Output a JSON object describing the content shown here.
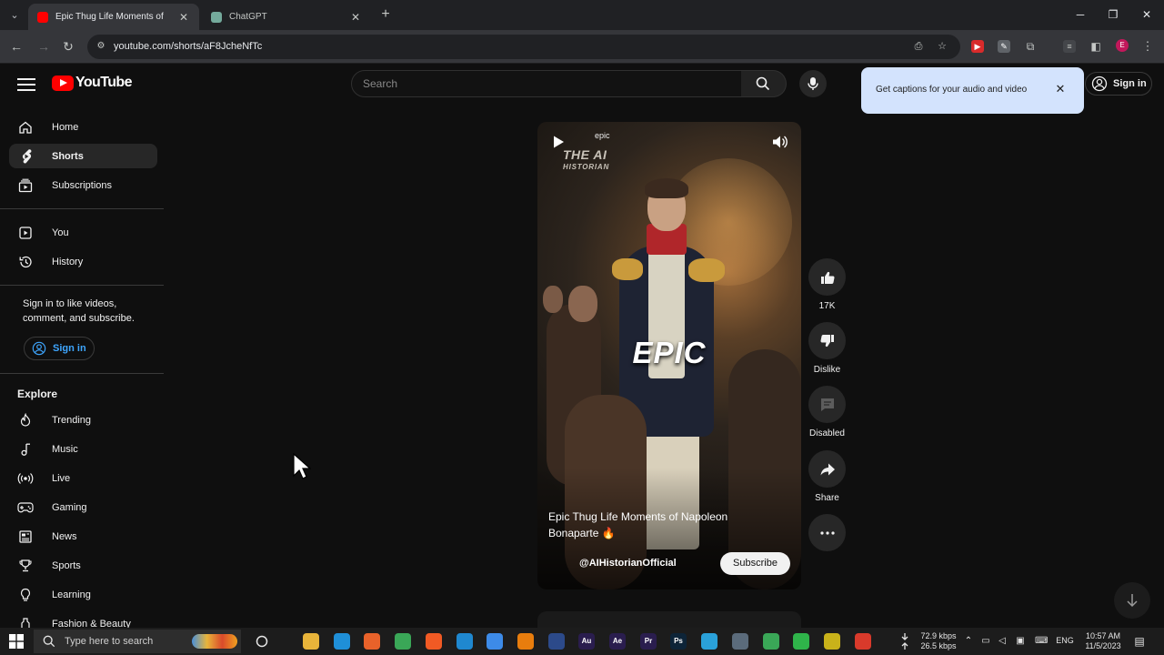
{
  "browser": {
    "tabs": [
      {
        "title": "Epic Thug Life Moments of",
        "favicon_color": "#ff0000",
        "active": true
      },
      {
        "title": "ChatGPT",
        "favicon_color": "#74aa9c",
        "active": false
      }
    ],
    "new_tab_symbol": "+",
    "url": "youtube.com/shorts/aF8JcheNfTc",
    "profile_initial": "E"
  },
  "youtube": {
    "logo_text": "YouTube",
    "search_placeholder": "Search",
    "sign_in_label": "Sign in",
    "caption_popup": "Get captions for your audio and video"
  },
  "sidebar": {
    "primary": [
      {
        "label": "Home",
        "icon": "home-icon"
      },
      {
        "label": "Shorts",
        "icon": "shorts-icon",
        "active": true
      },
      {
        "label": "Subscriptions",
        "icon": "subscriptions-icon"
      }
    ],
    "secondary": [
      {
        "label": "You",
        "icon": "you-icon"
      },
      {
        "label": "History",
        "icon": "history-icon"
      }
    ],
    "signin_note": "Sign in to like videos, comment, and subscribe.",
    "signin_label": "Sign in",
    "explore_title": "Explore",
    "explore": [
      {
        "label": "Trending",
        "icon": "trending-icon"
      },
      {
        "label": "Music",
        "icon": "music-icon"
      },
      {
        "label": "Live",
        "icon": "live-icon"
      },
      {
        "label": "Gaming",
        "icon": "gaming-icon"
      },
      {
        "label": "News",
        "icon": "news-icon"
      },
      {
        "label": "Sports",
        "icon": "sports-icon"
      },
      {
        "label": "Learning",
        "icon": "learning-icon"
      },
      {
        "label": "Fashion & Beauty",
        "icon": "fashion-icon"
      }
    ]
  },
  "short": {
    "channel_tag": "epic",
    "brand_line1": "THE AI",
    "brand_line2": "HISTORIAN",
    "overlay_text": "EPIC",
    "title": "Epic Thug Life Moments of Napoleon Bonaparte 🔥",
    "channel_handle": "@AIHistorianOfficial",
    "subscribe_label": "Subscribe"
  },
  "actions": {
    "like_count": "17K",
    "dislike_label": "Dislike",
    "comments_label": "Disabled",
    "share_label": "Share"
  },
  "taskbar": {
    "search_placeholder": "Type here to search",
    "apps": [
      {
        "name": "file-explorer-icon",
        "text": "",
        "color": "#e8b43a"
      },
      {
        "name": "edge-icon",
        "text": "",
        "color": "#1f8fd8"
      },
      {
        "name": "firefox-icon",
        "text": "",
        "color": "#e8622a"
      },
      {
        "name": "chrome-icon",
        "text": "",
        "color": "#3aa757"
      },
      {
        "name": "brave-icon",
        "text": "",
        "color": "#f15a24"
      },
      {
        "name": "vscode-icon",
        "text": "",
        "color": "#1f88d0"
      },
      {
        "name": "app-a-icon",
        "text": "",
        "color": "#3d8be8"
      },
      {
        "name": "blender-icon",
        "text": "",
        "color": "#e87d0d"
      },
      {
        "name": "cinema4d-icon",
        "text": "",
        "color": "#2c4a8a"
      },
      {
        "name": "audition-icon",
        "text": "Au",
        "color": "#2a1d4e"
      },
      {
        "name": "after-effects-icon",
        "text": "Ae",
        "color": "#2a1d4e"
      },
      {
        "name": "premiere-icon",
        "text": "Pr",
        "color": "#2a1d4e"
      },
      {
        "name": "photoshop-icon",
        "text": "Ps",
        "color": "#0d2438"
      },
      {
        "name": "telegram-icon",
        "text": "",
        "color": "#2aa1da"
      },
      {
        "name": "app-window-icon",
        "text": "",
        "color": "#5b6b7b"
      },
      {
        "name": "chrome-active-icon",
        "text": "",
        "color": "#3aa757"
      },
      {
        "name": "camtasia-icon",
        "text": "",
        "color": "#2fb44a"
      },
      {
        "name": "app-yellow-icon",
        "text": "",
        "color": "#c9b21a"
      },
      {
        "name": "recorder-icon",
        "text": "",
        "color": "#d93a2b"
      }
    ],
    "net_down": "72.9 kbps",
    "net_up": "26.5 kbps",
    "language": "ENG",
    "time": "10:57 AM",
    "date": "11/5/2023"
  }
}
